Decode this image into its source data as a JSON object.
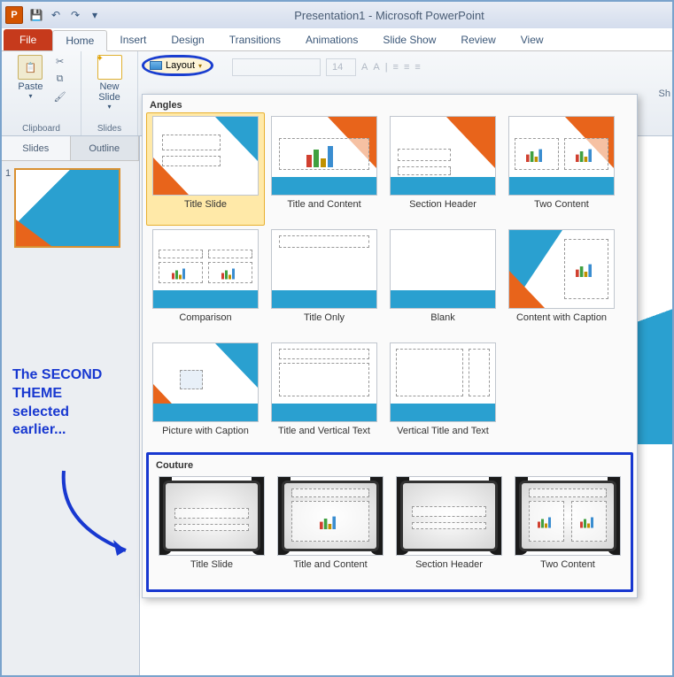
{
  "window": {
    "title": "Presentation1 - Microsoft PowerPoint",
    "app_badge": "P"
  },
  "qat": {
    "save": "💾",
    "undo": "↶",
    "redo": "↷",
    "more": "▾"
  },
  "tabs": {
    "file": "File",
    "home": "Home",
    "insert": "Insert",
    "design": "Design",
    "transitions": "Transitions",
    "animations": "Animations",
    "slideshow": "Slide Show",
    "review": "Review",
    "view": "View"
  },
  "ribbon": {
    "clipboard": {
      "label": "Clipboard",
      "paste": "Paste",
      "cut": "✂",
      "copy": "⧉",
      "painter": "🖌"
    },
    "slides": {
      "label": "Slides",
      "new_slide": "New\nSlide",
      "layout": "Layout",
      "layout_arrow": "▾"
    },
    "font_size_placeholder": "14",
    "shapes_hint": "Sh"
  },
  "leftpane": {
    "slides_tab": "Slides",
    "outline_tab": "Outline",
    "slide_number": "1"
  },
  "layout_popup": {
    "group1": "Angles",
    "group2": "Couture",
    "angles": [
      "Title Slide",
      "Title and Content",
      "Section Header",
      "Two Content",
      "Comparison",
      "Title Only",
      "Blank",
      "Content with Caption",
      "Picture with Caption",
      "Title and Vertical Text",
      "Vertical Title and Text"
    ],
    "couture": [
      "Title Slide",
      "Title and Content",
      "Section Header",
      "Two Content"
    ]
  },
  "annotation": {
    "text": "The SECOND THEME selected earlier..."
  }
}
